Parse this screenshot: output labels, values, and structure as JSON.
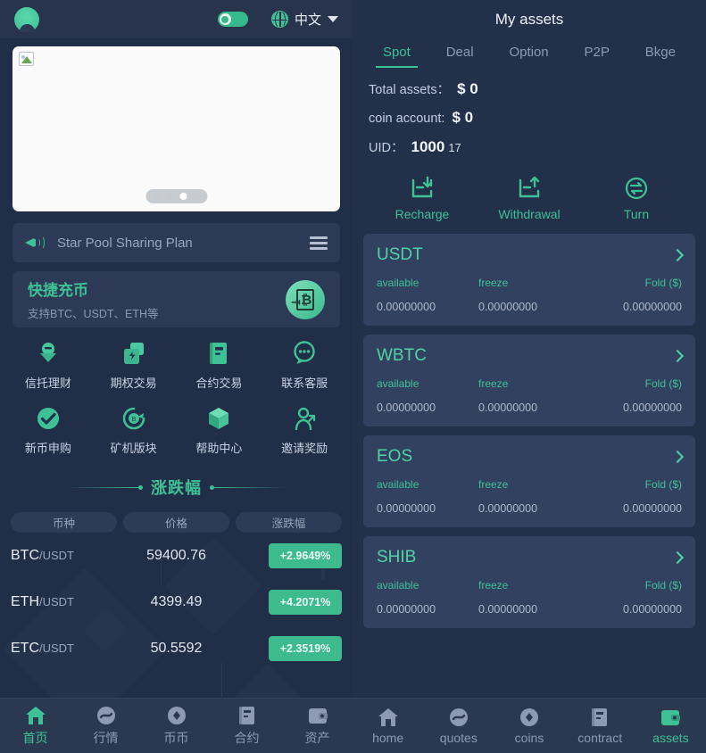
{
  "left": {
    "header": {
      "avatar": "user-avatar",
      "theme_toggle": "dark-mode-toggle",
      "globe_icon": "globe-icon",
      "language": "中文"
    },
    "banner": {
      "image_alt": "broken-image-placeholder",
      "dots": 4,
      "active_dot": 3
    },
    "notice": {
      "icon": "megaphone-icon",
      "text": "Star Pool Sharing Plan",
      "menu_icon": "hamburger-icon"
    },
    "quick_recharge": {
      "title": "快捷充币",
      "subtitle": "支持BTC、USDT、ETH等",
      "icon": "bitcoin-document-icon"
    },
    "grid": [
      {
        "icon": "trust-finance-icon",
        "label": "信托理财"
      },
      {
        "icon": "option-trading-icon",
        "label": "期权交易"
      },
      {
        "icon": "contract-trading-icon",
        "label": "合约交易"
      },
      {
        "icon": "customer-service-icon",
        "label": "联系客服"
      },
      {
        "icon": "new-coin-icon",
        "label": "新币申购"
      },
      {
        "icon": "mining-machine-icon",
        "label": "矿机版块"
      },
      {
        "icon": "help-center-icon",
        "label": "帮助中心"
      },
      {
        "icon": "invite-reward-icon",
        "label": "邀请奖励"
      }
    ],
    "market": {
      "title": "涨跌幅",
      "headers": [
        "币种",
        "价格",
        "涨跌幅"
      ],
      "rows": [
        {
          "base": "BTC",
          "quote": "/USDT",
          "price": "59400.76",
          "change": "+2.9649%"
        },
        {
          "base": "ETH",
          "quote": "/USDT",
          "price": "4399.49",
          "change": "+4.2071%"
        },
        {
          "base": "ETC",
          "quote": "/USDT",
          "price": "50.5592",
          "change": "+2.3519%"
        }
      ]
    },
    "nav": [
      {
        "icon": "home-icon",
        "label": "首页",
        "active": true
      },
      {
        "icon": "quotes-icon",
        "label": "行情",
        "active": false
      },
      {
        "icon": "coins-icon",
        "label": "币币",
        "active": false
      },
      {
        "icon": "contract-icon",
        "label": "合约",
        "active": false
      },
      {
        "icon": "assets-icon",
        "label": "资产",
        "active": false
      }
    ]
  },
  "right": {
    "title": "My assets",
    "tabs": [
      {
        "label": "Spot",
        "active": true
      },
      {
        "label": "Deal",
        "active": false
      },
      {
        "label": "Option",
        "active": false
      },
      {
        "label": "P2P",
        "active": false
      },
      {
        "label": "Bkge",
        "active": false
      }
    ],
    "summary": {
      "total_label": "Total assets：",
      "total_value": "$ 0",
      "coin_label": "coin account:",
      "coin_value": "$ 0",
      "uid_label": "UID：",
      "uid_value": "1000",
      "uid_suffix": "17"
    },
    "actions": [
      {
        "icon": "recharge-icon",
        "label": "Recharge"
      },
      {
        "icon": "withdrawal-icon",
        "label": "Withdrawal"
      },
      {
        "icon": "turn-icon",
        "label": "Turn"
      }
    ],
    "card_labels": {
      "available": "available",
      "freeze": "freeze",
      "fold": "Fold ($)"
    },
    "assets": [
      {
        "name": "USDT",
        "available": "0.00000000",
        "freeze": "0.00000000",
        "fold": "0.00000000"
      },
      {
        "name": "WBTC",
        "available": "0.00000000",
        "freeze": "0.00000000",
        "fold": "0.00000000"
      },
      {
        "name": "EOS",
        "available": "0.00000000",
        "freeze": "0.00000000",
        "fold": "0.00000000"
      },
      {
        "name": "SHIB",
        "available": "0.00000000",
        "freeze": "0.00000000",
        "fold": "0.00000000"
      }
    ],
    "nav": [
      {
        "icon": "home-icon",
        "label": "home",
        "active": false
      },
      {
        "icon": "quotes-icon",
        "label": "quotes",
        "active": false
      },
      {
        "icon": "coins-icon",
        "label": "coins",
        "active": false
      },
      {
        "icon": "contract-icon",
        "label": "contract",
        "active": false
      },
      {
        "icon": "assets-icon",
        "label": "assets",
        "active": true
      }
    ]
  },
  "colors": {
    "accent": "#3fc196",
    "page_bg": "#212e47",
    "card_bg": "#334160",
    "nav_bg": "#2b3950",
    "change_badge": "#3dba8e"
  }
}
